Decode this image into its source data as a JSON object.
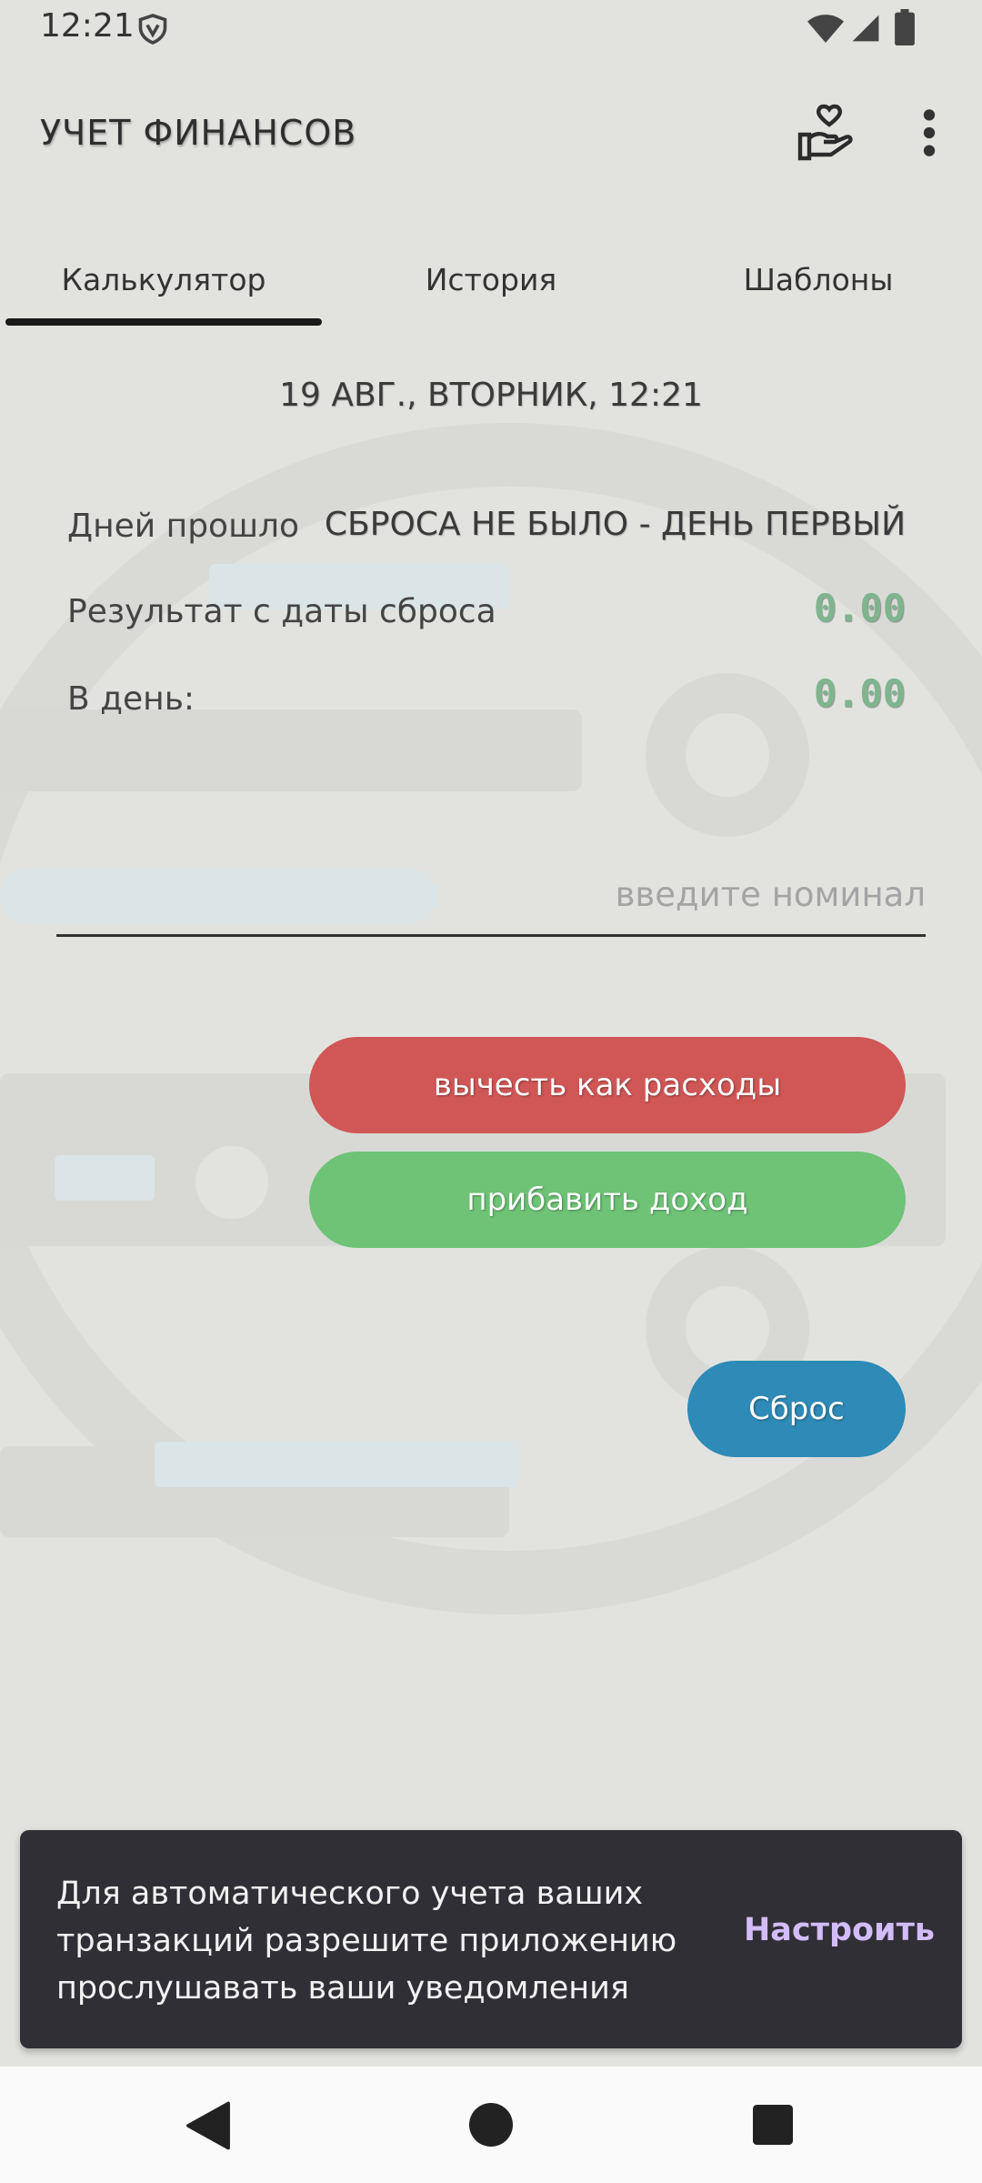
{
  "status_bar": {
    "time": "12:21",
    "icons": [
      "vpn-shield-icon",
      "wifi-icon",
      "signal-icon",
      "battery-icon"
    ]
  },
  "app_bar": {
    "title": "УЧЕТ ФИНАНСОВ",
    "actions": [
      "donate-hand-heart-icon",
      "more-vert-icon"
    ]
  },
  "tabs": [
    {
      "label": "Калькулятор",
      "selected": true
    },
    {
      "label": "История",
      "selected": false
    },
    {
      "label": "Шаблоны",
      "selected": false
    }
  ],
  "calculator": {
    "date_line": "19 АВГ., ВТОРНИК, 12:21",
    "rows": [
      {
        "label": "Дней прошло",
        "value": "СБРОСА НЕ БЫЛО - ДЕНЬ ПЕРВЫЙ"
      },
      {
        "label": "Результат с даты сброса",
        "value": "0.00"
      },
      {
        "label": "В день:",
        "value": "0.00"
      }
    ],
    "input": {
      "placeholder": "введите номинал",
      "value": ""
    },
    "buttons": {
      "expense": "вычесть как расходы",
      "income": "прибавить доход",
      "reset": "Сброс"
    }
  },
  "snackbar": {
    "message": "Для автоматического учета ваших транзакций разрешите приложению прослушавать ваши уведомления",
    "action": "Настроить"
  },
  "colors": {
    "background": "#e2e3df",
    "expense": "#d05756",
    "income": "#6ec376",
    "reset": "#2e8ab6",
    "value_green": "#7fb58e",
    "snackbar_bg": "#302f35",
    "snackbar_action": "#d2bcfa"
  }
}
